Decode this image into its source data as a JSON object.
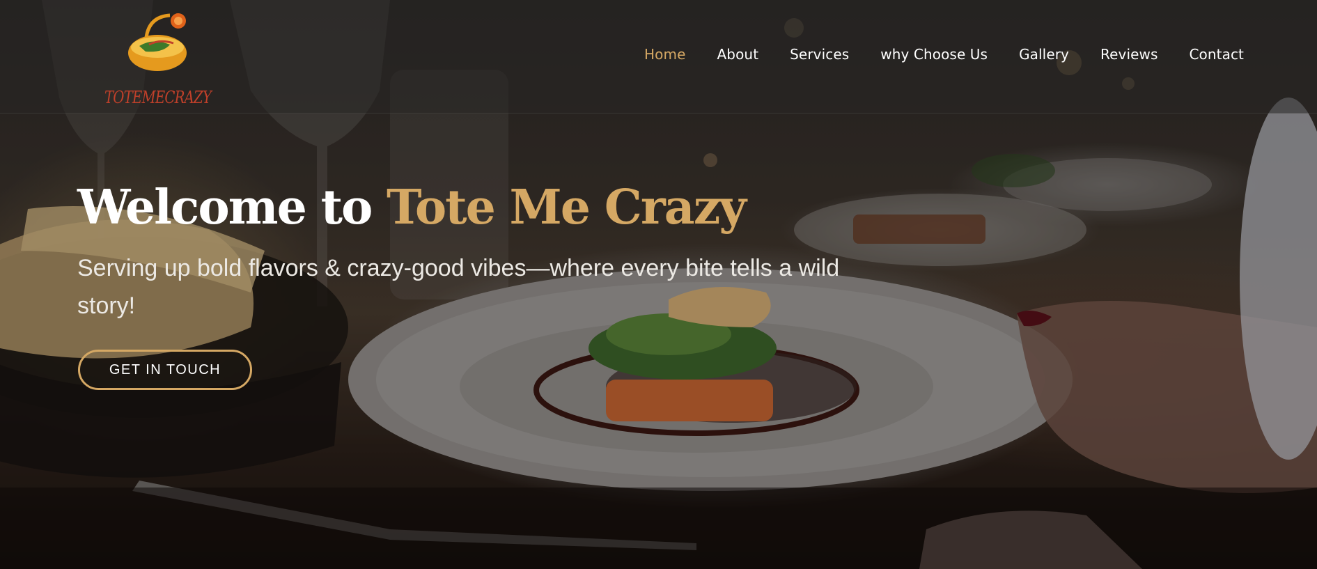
{
  "brand": {
    "logo_text": "TOTEMECRAZY",
    "logo_icon": "food-bowl-logo-icon"
  },
  "nav": {
    "items": [
      {
        "label": "Home",
        "active": true
      },
      {
        "label": "About",
        "active": false
      },
      {
        "label": "Services",
        "active": false
      },
      {
        "label": "why Choose Us",
        "active": false
      },
      {
        "label": "Gallery",
        "active": false
      },
      {
        "label": "Reviews",
        "active": false
      },
      {
        "label": "Contact",
        "active": false
      }
    ]
  },
  "hero": {
    "title_prefix": "Welcome to ",
    "title_accent": "Tote Me Crazy",
    "subtitle": "Serving up bold flavors & crazy-good vibes—where every bite tells a wild story!",
    "cta_label": "GET IN TOUCH"
  },
  "colors": {
    "accent": "#d5a864",
    "text": "#ffffff",
    "logo_text": "#c0402a"
  }
}
